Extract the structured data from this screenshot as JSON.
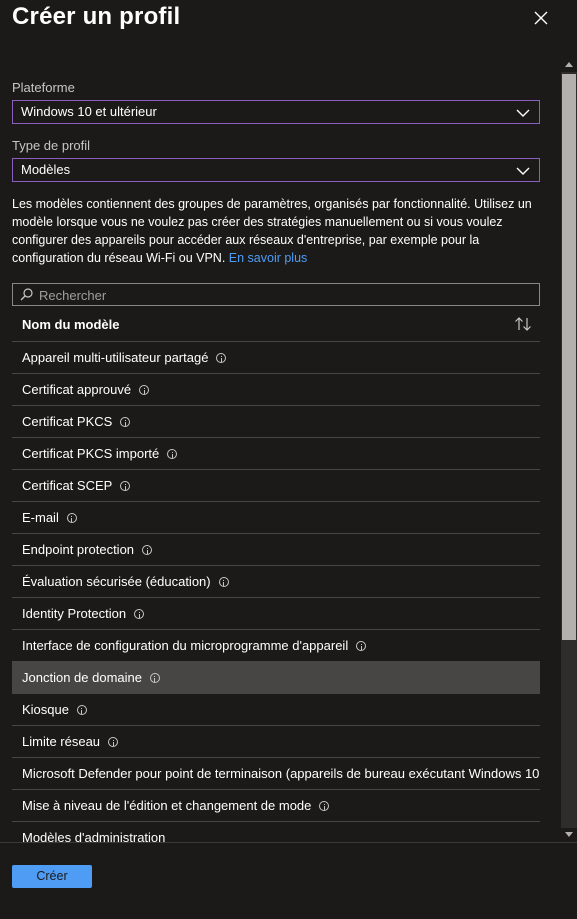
{
  "panel": {
    "title": "Créer un profil"
  },
  "platform": {
    "label": "Plateforme",
    "value": "Windows 10 et ultérieur"
  },
  "profile_type": {
    "label": "Type de profil",
    "value": "Modèles"
  },
  "description": {
    "text": "Les modèles contiennent des groupes de paramètres, organisés par fonctionnalité. Utilisez un modèle lorsque vous ne voulez pas créer des stratégies manuellement ou si vous voulez configurer des appareils pour accéder aux réseaux d'entreprise, par exemple pour la configuration du réseau Wi-Fi ou VPN.",
    "link": "En savoir plus"
  },
  "search": {
    "placeholder": "Rechercher"
  },
  "table": {
    "column": "Nom du modèle",
    "rows": [
      {
        "name": "Appareil multi-utilisateur partagé",
        "info": true
      },
      {
        "name": "Certificat approuvé",
        "info": true
      },
      {
        "name": "Certificat PKCS",
        "info": true
      },
      {
        "name": "Certificat PKCS importé",
        "info": true
      },
      {
        "name": "Certificat SCEP",
        "info": true
      },
      {
        "name": "E-mail",
        "info": true
      },
      {
        "name": "Endpoint protection",
        "info": true
      },
      {
        "name": "Évaluation sécurisée (éducation)",
        "info": true
      },
      {
        "name": "Identity Protection",
        "info": true
      },
      {
        "name": "Interface de configuration du microprogramme d'appareil",
        "info": true
      },
      {
        "name": "Jonction de domaine",
        "info": true,
        "selected": true
      },
      {
        "name": "Kiosque",
        "info": true
      },
      {
        "name": "Limite réseau",
        "info": true
      },
      {
        "name": "Microsoft Defender pour point de terminaison (appareils de bureau exécutant Windows 10",
        "info": false
      },
      {
        "name": "Mise à niveau de l'édition et changement de mode",
        "info": true
      },
      {
        "name": "Modèles d'administration",
        "info": false
      }
    ]
  },
  "footer": {
    "create_label": "Créer"
  },
  "colors": {
    "accent": "#4f9cf5",
    "focus_border": "#8b5fbf",
    "selected_row": "#484644"
  }
}
